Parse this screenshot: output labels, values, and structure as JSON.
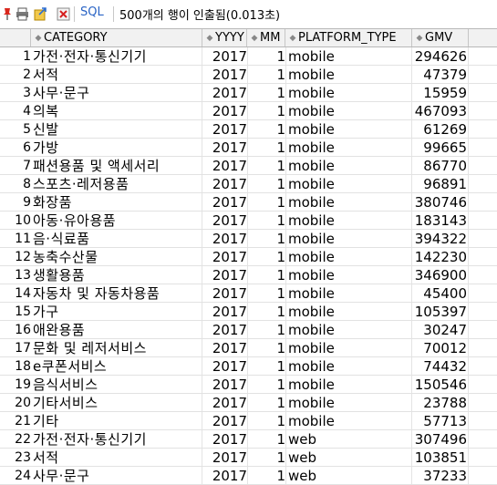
{
  "toolbar": {
    "sql_label": "SQL",
    "status_text": "500개의 행이 인출됨(0.013초)"
  },
  "grid": {
    "columns": [
      "CATEGORY",
      "YYYY",
      "MM",
      "PLATFORM_TYPE",
      "GMV"
    ],
    "rows": [
      {
        "no": "1",
        "category": "가전·전자·통신기기",
        "yyyy": "2017",
        "mm": "1",
        "platform": "mobile",
        "gmv": "294626"
      },
      {
        "no": "2",
        "category": "서적",
        "yyyy": "2017",
        "mm": "1",
        "platform": "mobile",
        "gmv": "47379"
      },
      {
        "no": "3",
        "category": "사무·문구",
        "yyyy": "2017",
        "mm": "1",
        "platform": "mobile",
        "gmv": "15959"
      },
      {
        "no": "4",
        "category": "의복",
        "yyyy": "2017",
        "mm": "1",
        "platform": "mobile",
        "gmv": "467093"
      },
      {
        "no": "5",
        "category": "신발",
        "yyyy": "2017",
        "mm": "1",
        "platform": "mobile",
        "gmv": "61269"
      },
      {
        "no": "6",
        "category": "가방",
        "yyyy": "2017",
        "mm": "1",
        "platform": "mobile",
        "gmv": "99665"
      },
      {
        "no": "7",
        "category": "패션용품 및 액세서리",
        "yyyy": "2017",
        "mm": "1",
        "platform": "mobile",
        "gmv": "86770"
      },
      {
        "no": "8",
        "category": "스포츠·레저용품",
        "yyyy": "2017",
        "mm": "1",
        "platform": "mobile",
        "gmv": "96891"
      },
      {
        "no": "9",
        "category": "화장품",
        "yyyy": "2017",
        "mm": "1",
        "platform": "mobile",
        "gmv": "380746"
      },
      {
        "no": "10",
        "category": "아동·유아용품",
        "yyyy": "2017",
        "mm": "1",
        "platform": "mobile",
        "gmv": "183143"
      },
      {
        "no": "11",
        "category": "음·식료품",
        "yyyy": "2017",
        "mm": "1",
        "platform": "mobile",
        "gmv": "394322"
      },
      {
        "no": "12",
        "category": "농축수산물",
        "yyyy": "2017",
        "mm": "1",
        "platform": "mobile",
        "gmv": "142230"
      },
      {
        "no": "13",
        "category": "생활용품",
        "yyyy": "2017",
        "mm": "1",
        "platform": "mobile",
        "gmv": "346900"
      },
      {
        "no": "14",
        "category": "자동차 및 자동차용품",
        "yyyy": "2017",
        "mm": "1",
        "platform": "mobile",
        "gmv": "45400"
      },
      {
        "no": "15",
        "category": "가구",
        "yyyy": "2017",
        "mm": "1",
        "platform": "mobile",
        "gmv": "105397"
      },
      {
        "no": "16",
        "category": "애완용품",
        "yyyy": "2017",
        "mm": "1",
        "platform": "mobile",
        "gmv": "30247"
      },
      {
        "no": "17",
        "category": "문화 및 레저서비스",
        "yyyy": "2017",
        "mm": "1",
        "platform": "mobile",
        "gmv": "70012"
      },
      {
        "no": "18",
        "category": "e쿠폰서비스",
        "yyyy": "2017",
        "mm": "1",
        "platform": "mobile",
        "gmv": "74432"
      },
      {
        "no": "19",
        "category": "음식서비스",
        "yyyy": "2017",
        "mm": "1",
        "platform": "mobile",
        "gmv": "150546"
      },
      {
        "no": "20",
        "category": "기타서비스",
        "yyyy": "2017",
        "mm": "1",
        "platform": "mobile",
        "gmv": "23788"
      },
      {
        "no": "21",
        "category": "기타",
        "yyyy": "2017",
        "mm": "1",
        "platform": "mobile",
        "gmv": "57713"
      },
      {
        "no": "22",
        "category": "가전·전자·통신기기",
        "yyyy": "2017",
        "mm": "1",
        "platform": "web",
        "gmv": "307496"
      },
      {
        "no": "23",
        "category": "서적",
        "yyyy": "2017",
        "mm": "1",
        "platform": "web",
        "gmv": "103851"
      },
      {
        "no": "24",
        "category": "사무·문구",
        "yyyy": "2017",
        "mm": "1",
        "platform": "web",
        "gmv": "37233"
      }
    ]
  }
}
